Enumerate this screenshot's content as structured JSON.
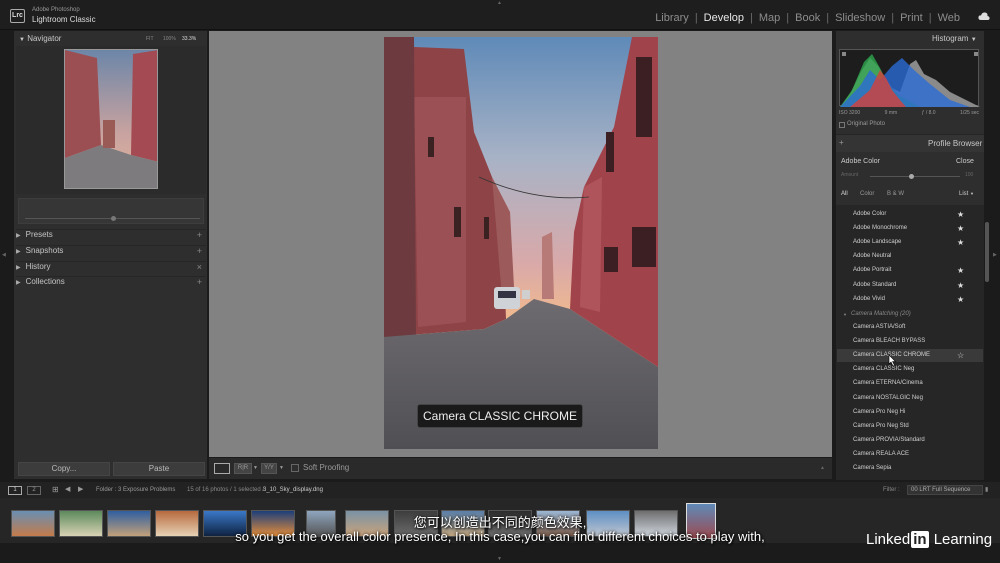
{
  "app": {
    "vendor": "Adobe Photoshop",
    "name": "Lightroom Classic",
    "logo": "Lrc",
    "modules": [
      "Library",
      "Develop",
      "Map",
      "Book",
      "Slideshow",
      "Print",
      "Web"
    ],
    "active_module": "Develop",
    "cloud_icon": "cloud-icon"
  },
  "navigator": {
    "title": "Navigator",
    "zoom_options": [
      "FIT",
      "100%",
      "33.3%"
    ]
  },
  "left_panel": {
    "sections": [
      "Presets",
      "Snapshots",
      "History",
      "Collections"
    ],
    "copy_label": "Copy...",
    "paste_label": "Paste"
  },
  "center": {
    "caption": "Camera CLASSIC CHROME",
    "soft_proofing": "Soft Proofing"
  },
  "right_panel": {
    "histogram_title": "Histogram",
    "exif": [
      "ISO 3200",
      "9 mm",
      "ƒ / 8.0",
      "1/25 sec"
    ],
    "original_photo": "Original Photo",
    "profile_browser_title": "Profile Browser",
    "current_profile": "Adobe Color",
    "close_label": "Close",
    "amount_label": "Amount",
    "amount_value": "100",
    "filters": [
      "All",
      "Color",
      "B & W"
    ],
    "view_label": "List",
    "adobe_profiles": [
      {
        "name": "Adobe Color",
        "star": "★"
      },
      {
        "name": "Adobe Monochrome",
        "star": "★"
      },
      {
        "name": "Adobe Landscape",
        "star": "★"
      },
      {
        "name": "Adobe Neutral",
        "star": ""
      },
      {
        "name": "Adobe Portrait",
        "star": "★"
      },
      {
        "name": "Adobe Standard",
        "star": "★"
      },
      {
        "name": "Adobe Vivid",
        "star": "★"
      }
    ],
    "group_label": "Camera Matching (20)",
    "camera_profiles": [
      {
        "name": "Camera ASTIA/Soft",
        "star": ""
      },
      {
        "name": "Camera BLEACH BYPASS",
        "star": ""
      },
      {
        "name": "Camera CLASSIC CHROME",
        "star": "☆"
      },
      {
        "name": "Camera CLASSIC Neg",
        "star": ""
      },
      {
        "name": "Camera ETERNA/Cinema",
        "star": ""
      },
      {
        "name": "Camera NOSTALGIC Neg",
        "star": ""
      },
      {
        "name": "Camera Pro Neg Hi",
        "star": ""
      },
      {
        "name": "Camera Pro Neg Std",
        "star": ""
      },
      {
        "name": "Camera PROVIA/Standard",
        "star": ""
      },
      {
        "name": "Camera REALA ACE",
        "star": ""
      },
      {
        "name": "Camera Sepia",
        "star": ""
      }
    ]
  },
  "filmstrip": {
    "screens": [
      "1",
      "2"
    ],
    "folder": "Folder : 3 Exposure Problems",
    "count": "15 of 16 photos / 1 selected /",
    "filename": "3_10_Sky_display.dng",
    "filter_label": "Filter :",
    "filter_value": "00 LRT Full Sequence"
  },
  "subtitles": {
    "zh": "您可以创造出不同的颜色效果,",
    "en": "so you get the overall color presence, In this case,you can find different choices to play with,"
  },
  "watermark": {
    "part1": "Linked",
    "part2": "in",
    "part3": "Learning"
  }
}
